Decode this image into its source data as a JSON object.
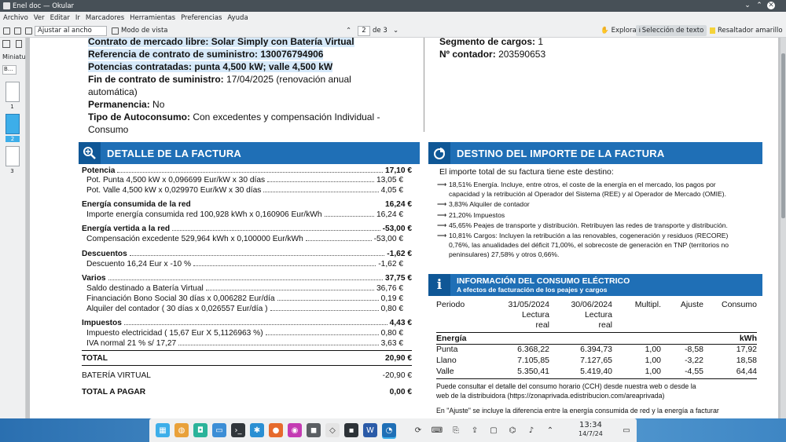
{
  "window": {
    "title": "Enel doc — Okular"
  },
  "menu": [
    "Archivo",
    "Ver",
    "Editar",
    "Ir",
    "Marcadores",
    "Herramientas",
    "Preferencias",
    "Ayuda"
  ],
  "toolbar": {
    "zoom": "Ajustar al ancho",
    "view_mode": "Modo de vista",
    "page": "2",
    "of": "de",
    "total": "3",
    "explore": "Explorar",
    "text_select": "Selección de texto",
    "highlighter": "Resaltador amarillo"
  },
  "sidebar": {
    "label": "Miniatu",
    "search": "B...",
    "pages": [
      "1",
      "2",
      "3"
    ]
  },
  "contract": {
    "line1": "Contrato de mercado libre: Solar Simply con Batería Virtual",
    "line2": "Referencia de contrato de suministro: 130076794906",
    "line3": "Potencias contratadas: punta 4,500 kW; valle 4,500 kW",
    "end_label": "Fin de contrato de suministro:",
    "end_value": "17/04/2025 (renovación anual",
    "end_value2": "automática)",
    "perm_label": "Permanencia:",
    "perm_value": "No",
    "auto_label": "Tipo de Autoconsumo:",
    "auto_value": "Con excedentes y compensación Individual -",
    "auto_value2": "Consumo",
    "seg_label": "Segmento de cargos:",
    "seg_value": "1",
    "meter_label": "Nº contador:",
    "meter_value": "203590653"
  },
  "detalle": {
    "title": "DETALLE DE LA FACTURA",
    "potencia": {
      "label": "Potencia",
      "total": "17,10 €",
      "l1": "Pot. Punta 4,500 kW x 0,096699 Eur/kW x 30 días",
      "v1": "13,05 €",
      "l2": "Pot. Valle 4,500 kW x 0,029970 Eur/kW x 30 días",
      "v2": "4,05 €"
    },
    "energia": {
      "label": "Energía consumida de la red",
      "total": "16,24 €",
      "l1": "Importe energía consumida red 100,928 kWh x 0,160906 Eur/kWh",
      "v1": "16,24 €"
    },
    "vertida": {
      "label": "Energía vertida a la red",
      "total": "-53,00 €",
      "l1": "Compensación excedente 529,964 kWh x 0,100000 Eur/kWh",
      "v1": "-53,00 €"
    },
    "descuentos": {
      "label": "Descuentos",
      "total": "-1,62 €",
      "l1": "Descuento 16,24  Eur x -10  %",
      "v1": "-1,62 €"
    },
    "varios": {
      "label": "Varios",
      "total": "37,75 €",
      "l1": "Saldo destinado a Batería Virtual",
      "v1": "36,76 €",
      "l2": "Financiación Bono Social 30  días x 0,006282 Eur/día",
      "v2": "0,19 €",
      "l3": "Alquiler del contador ( 30  días x 0,026557  Eur/día )",
      "v3": "0,80 €"
    },
    "impuestos": {
      "label": "Impuestos",
      "total": "4,43 €",
      "l1": "Impuesto electricidad ( 15,67  Eur X 5,1126963  %)",
      "v1": "0,80 €",
      "l2": "IVA normal 21 %     s/ 17,27",
      "v2": "3,63 €"
    },
    "total_label": "TOTAL",
    "total_value": "20,90 €",
    "bateria_label": "BATERÍA VIRTUAL",
    "bateria_value": "-20,90 €",
    "pagar_label": "TOTAL A PAGAR",
    "pagar_value": "0,00 €"
  },
  "destino": {
    "title": "DESTINO DEL IMPORTE DE LA FACTURA",
    "intro": "El importe total de su factura tiene este destino:",
    "items": [
      [
        "18,51% Energía. Incluye, entre otros, el coste de la energía en el mercado, los pagos por",
        "capacidad y la retribución al Operador del Sistema (REE) y al Operador de Mercado (OMIE)."
      ],
      [
        "3,83% Alquiler de contador"
      ],
      [
        "21,20% Impuestos"
      ],
      [
        "45,65% Peajes de transporte y distribución. Retribuyen las redes de transporte y distribución."
      ],
      [
        "10,81% Cargos: Incluyen la retribución a las renovables, cogeneración y residuos (RECORE)",
        "0,76%, las anualidades del déficit 71,00%, el sobrecoste de generación en TNP (territorios no",
        "peninsulares) 27,58% y otros 0,66%."
      ]
    ]
  },
  "consumo": {
    "title": "INFORMACIÓN DEL CONSUMO ELÉCTRICO",
    "subtitle": "A efectos de facturación de los peajes y cargos",
    "headers": [
      "Periodo",
      "31/05/2024",
      "30/06/2024",
      "Multipl.",
      "Ajuste",
      "Consumo"
    ],
    "sub1": "Lectura",
    "sub2": "real",
    "section": "Energía",
    "unit": "kWh",
    "rows": [
      [
        "Punta",
        "6.368,22",
        "6.394,73",
        "1,00",
        "-8,58",
        "17,92"
      ],
      [
        "Llano",
        "7.105,85",
        "7.127,65",
        "1,00",
        "-3,22",
        "18,58"
      ],
      [
        "Valle",
        "5.350,41",
        "5.419,40",
        "1,00",
        "-4,55",
        "64,44"
      ]
    ],
    "note1": "Puede consultar el detalle del consumo horario (CCH) desde nuestra web o desde la",
    "note2": "web de la distribuidora (https://zonaprivada.edistribucion.com/areaprivada)",
    "note3": "En \"Ajuste\" se incluye la diferencia entre la energía consumida de red y la energía a facturar"
  },
  "taskbar": {
    "time": "13:34",
    "date": "14/7/24"
  }
}
